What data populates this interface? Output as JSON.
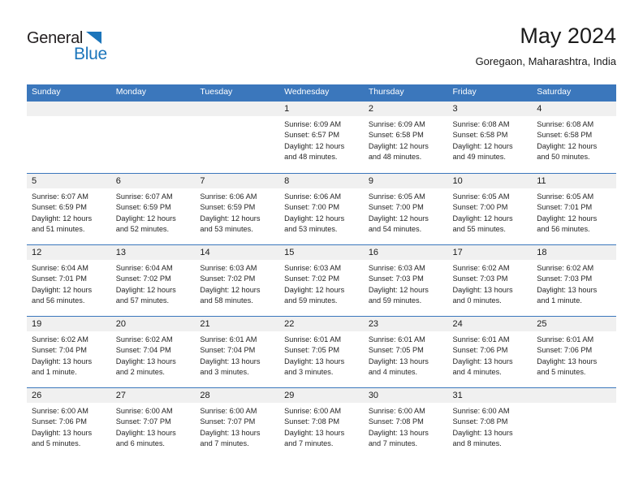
{
  "brand": {
    "name_dark": "General",
    "name_blue": "Blue",
    "accent_color": "#1b75bb"
  },
  "header": {
    "title": "May 2024",
    "location": "Goregaon, Maharashtra, India"
  },
  "theme": {
    "header_blue": "#3b77bc",
    "day_band_gray": "#f0f0f0",
    "text_color": "#262626"
  },
  "calendar": {
    "weekday_headers": [
      "Sunday",
      "Monday",
      "Tuesday",
      "Wednesday",
      "Thursday",
      "Friday",
      "Saturday"
    ],
    "weeks": [
      [
        {
          "day": "",
          "empty": true,
          "sunrise": "",
          "sunset": "",
          "daylight1": "",
          "daylight2": ""
        },
        {
          "day": "",
          "empty": true,
          "sunrise": "",
          "sunset": "",
          "daylight1": "",
          "daylight2": ""
        },
        {
          "day": "",
          "empty": true,
          "sunrise": "",
          "sunset": "",
          "daylight1": "",
          "daylight2": ""
        },
        {
          "day": "1",
          "sunrise": "Sunrise: 6:09 AM",
          "sunset": "Sunset: 6:57 PM",
          "daylight1": "Daylight: 12 hours",
          "daylight2": "and 48 minutes."
        },
        {
          "day": "2",
          "sunrise": "Sunrise: 6:09 AM",
          "sunset": "Sunset: 6:58 PM",
          "daylight1": "Daylight: 12 hours",
          "daylight2": "and 48 minutes."
        },
        {
          "day": "3",
          "sunrise": "Sunrise: 6:08 AM",
          "sunset": "Sunset: 6:58 PM",
          "daylight1": "Daylight: 12 hours",
          "daylight2": "and 49 minutes."
        },
        {
          "day": "4",
          "sunrise": "Sunrise: 6:08 AM",
          "sunset": "Sunset: 6:58 PM",
          "daylight1": "Daylight: 12 hours",
          "daylight2": "and 50 minutes."
        }
      ],
      [
        {
          "day": "5",
          "sunrise": "Sunrise: 6:07 AM",
          "sunset": "Sunset: 6:59 PM",
          "daylight1": "Daylight: 12 hours",
          "daylight2": "and 51 minutes."
        },
        {
          "day": "6",
          "sunrise": "Sunrise: 6:07 AM",
          "sunset": "Sunset: 6:59 PM",
          "daylight1": "Daylight: 12 hours",
          "daylight2": "and 52 minutes."
        },
        {
          "day": "7",
          "sunrise": "Sunrise: 6:06 AM",
          "sunset": "Sunset: 6:59 PM",
          "daylight1": "Daylight: 12 hours",
          "daylight2": "and 53 minutes."
        },
        {
          "day": "8",
          "sunrise": "Sunrise: 6:06 AM",
          "sunset": "Sunset: 7:00 PM",
          "daylight1": "Daylight: 12 hours",
          "daylight2": "and 53 minutes."
        },
        {
          "day": "9",
          "sunrise": "Sunrise: 6:05 AM",
          "sunset": "Sunset: 7:00 PM",
          "daylight1": "Daylight: 12 hours",
          "daylight2": "and 54 minutes."
        },
        {
          "day": "10",
          "sunrise": "Sunrise: 6:05 AM",
          "sunset": "Sunset: 7:00 PM",
          "daylight1": "Daylight: 12 hours",
          "daylight2": "and 55 minutes."
        },
        {
          "day": "11",
          "sunrise": "Sunrise: 6:05 AM",
          "sunset": "Sunset: 7:01 PM",
          "daylight1": "Daylight: 12 hours",
          "daylight2": "and 56 minutes."
        }
      ],
      [
        {
          "day": "12",
          "sunrise": "Sunrise: 6:04 AM",
          "sunset": "Sunset: 7:01 PM",
          "daylight1": "Daylight: 12 hours",
          "daylight2": "and 56 minutes."
        },
        {
          "day": "13",
          "sunrise": "Sunrise: 6:04 AM",
          "sunset": "Sunset: 7:02 PM",
          "daylight1": "Daylight: 12 hours",
          "daylight2": "and 57 minutes."
        },
        {
          "day": "14",
          "sunrise": "Sunrise: 6:03 AM",
          "sunset": "Sunset: 7:02 PM",
          "daylight1": "Daylight: 12 hours",
          "daylight2": "and 58 minutes."
        },
        {
          "day": "15",
          "sunrise": "Sunrise: 6:03 AM",
          "sunset": "Sunset: 7:02 PM",
          "daylight1": "Daylight: 12 hours",
          "daylight2": "and 59 minutes."
        },
        {
          "day": "16",
          "sunrise": "Sunrise: 6:03 AM",
          "sunset": "Sunset: 7:03 PM",
          "daylight1": "Daylight: 12 hours",
          "daylight2": "and 59 minutes."
        },
        {
          "day": "17",
          "sunrise": "Sunrise: 6:02 AM",
          "sunset": "Sunset: 7:03 PM",
          "daylight1": "Daylight: 13 hours",
          "daylight2": "and 0 minutes."
        },
        {
          "day": "18",
          "sunrise": "Sunrise: 6:02 AM",
          "sunset": "Sunset: 7:03 PM",
          "daylight1": "Daylight: 13 hours",
          "daylight2": "and 1 minute."
        }
      ],
      [
        {
          "day": "19",
          "sunrise": "Sunrise: 6:02 AM",
          "sunset": "Sunset: 7:04 PM",
          "daylight1": "Daylight: 13 hours",
          "daylight2": "and 1 minute."
        },
        {
          "day": "20",
          "sunrise": "Sunrise: 6:02 AM",
          "sunset": "Sunset: 7:04 PM",
          "daylight1": "Daylight: 13 hours",
          "daylight2": "and 2 minutes."
        },
        {
          "day": "21",
          "sunrise": "Sunrise: 6:01 AM",
          "sunset": "Sunset: 7:04 PM",
          "daylight1": "Daylight: 13 hours",
          "daylight2": "and 3 minutes."
        },
        {
          "day": "22",
          "sunrise": "Sunrise: 6:01 AM",
          "sunset": "Sunset: 7:05 PM",
          "daylight1": "Daylight: 13 hours",
          "daylight2": "and 3 minutes."
        },
        {
          "day": "23",
          "sunrise": "Sunrise: 6:01 AM",
          "sunset": "Sunset: 7:05 PM",
          "daylight1": "Daylight: 13 hours",
          "daylight2": "and 4 minutes."
        },
        {
          "day": "24",
          "sunrise": "Sunrise: 6:01 AM",
          "sunset": "Sunset: 7:06 PM",
          "daylight1": "Daylight: 13 hours",
          "daylight2": "and 4 minutes."
        },
        {
          "day": "25",
          "sunrise": "Sunrise: 6:01 AM",
          "sunset": "Sunset: 7:06 PM",
          "daylight1": "Daylight: 13 hours",
          "daylight2": "and 5 minutes."
        }
      ],
      [
        {
          "day": "26",
          "sunrise": "Sunrise: 6:00 AM",
          "sunset": "Sunset: 7:06 PM",
          "daylight1": "Daylight: 13 hours",
          "daylight2": "and 5 minutes."
        },
        {
          "day": "27",
          "sunrise": "Sunrise: 6:00 AM",
          "sunset": "Sunset: 7:07 PM",
          "daylight1": "Daylight: 13 hours",
          "daylight2": "and 6 minutes."
        },
        {
          "day": "28",
          "sunrise": "Sunrise: 6:00 AM",
          "sunset": "Sunset: 7:07 PM",
          "daylight1": "Daylight: 13 hours",
          "daylight2": "and 7 minutes."
        },
        {
          "day": "29",
          "sunrise": "Sunrise: 6:00 AM",
          "sunset": "Sunset: 7:08 PM",
          "daylight1": "Daylight: 13 hours",
          "daylight2": "and 7 minutes."
        },
        {
          "day": "30",
          "sunrise": "Sunrise: 6:00 AM",
          "sunset": "Sunset: 7:08 PM",
          "daylight1": "Daylight: 13 hours",
          "daylight2": "and 7 minutes."
        },
        {
          "day": "31",
          "sunrise": "Sunrise: 6:00 AM",
          "sunset": "Sunset: 7:08 PM",
          "daylight1": "Daylight: 13 hours",
          "daylight2": "and 8 minutes."
        },
        {
          "day": "",
          "empty": true,
          "sunrise": "",
          "sunset": "",
          "daylight1": "",
          "daylight2": ""
        }
      ]
    ]
  }
}
